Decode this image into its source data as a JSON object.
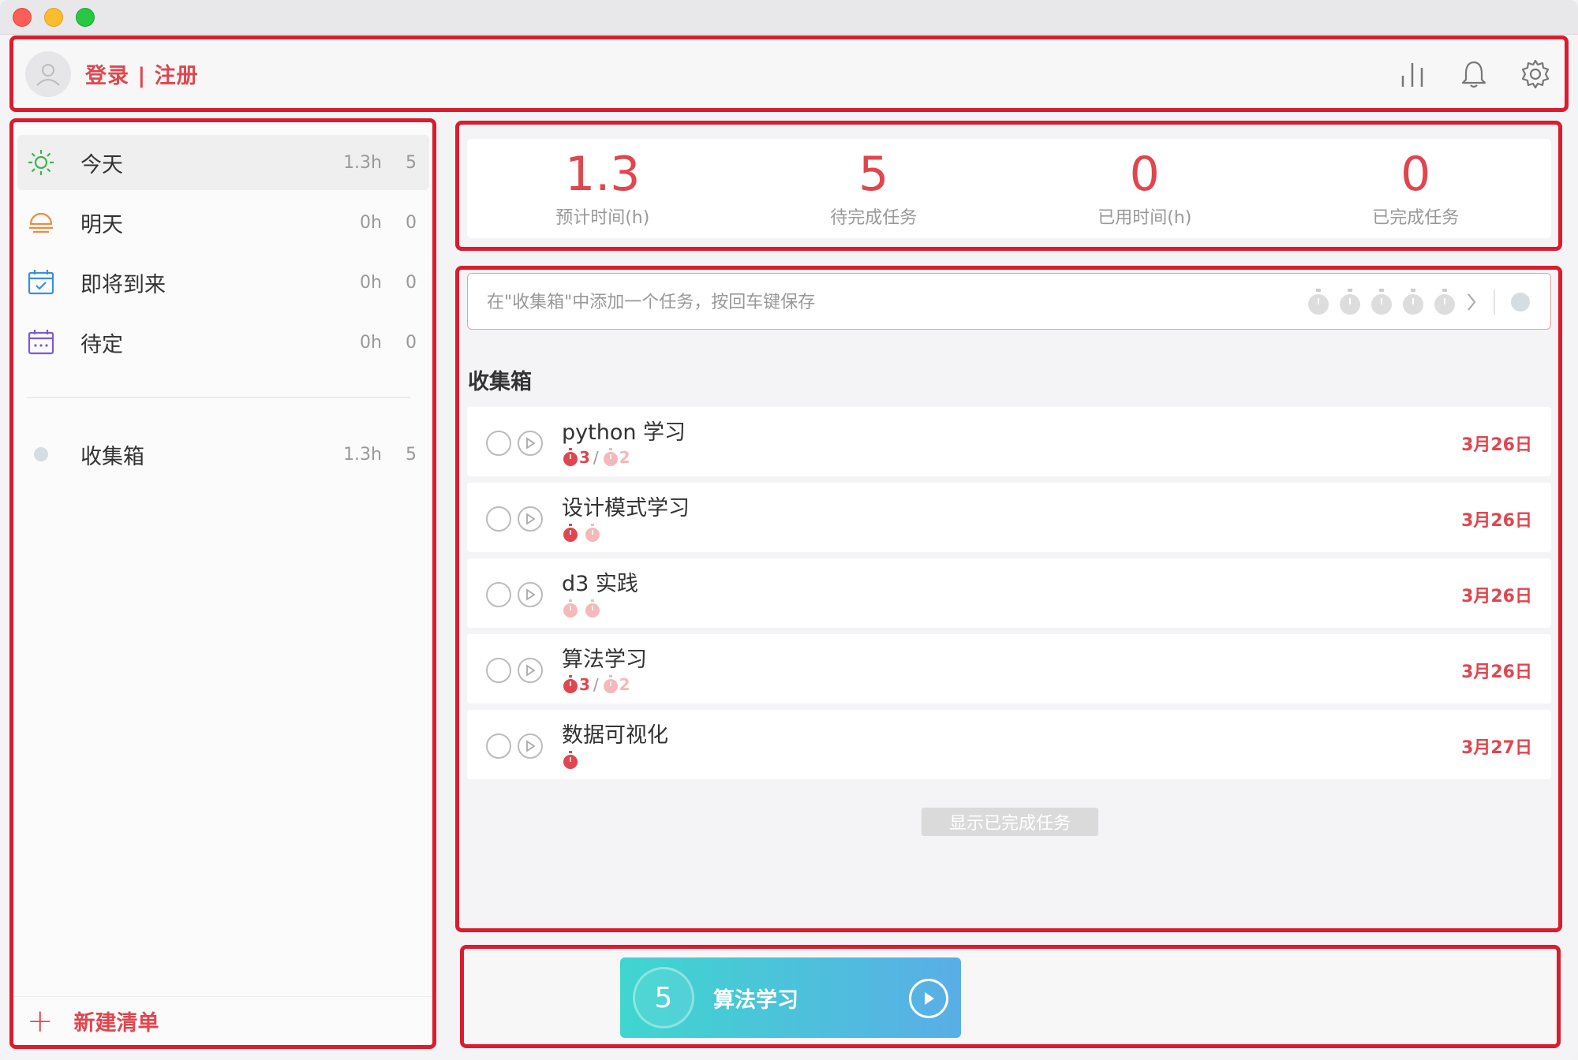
{
  "header": {
    "login_label": "登录 | 注册"
  },
  "sidebar": {
    "items": [
      {
        "label": "今天",
        "hours": "1.3h",
        "count": "5",
        "icon": "sun-icon",
        "color": "#3bb54a"
      },
      {
        "label": "明天",
        "hours": "0h",
        "count": "0",
        "icon": "sunrise-icon",
        "color": "#f08a3c"
      },
      {
        "label": "即将到来",
        "hours": "0h",
        "count": "0",
        "icon": "calendar-check-icon",
        "color": "#3b8ee0"
      },
      {
        "label": "待定",
        "hours": "0h",
        "count": "0",
        "icon": "calendar-dots-icon",
        "color": "#7a5ccf"
      }
    ],
    "lists": [
      {
        "label": "收集箱",
        "hours": "1.3h",
        "count": "5"
      }
    ],
    "new_list_label": "新建清单"
  },
  "stats": [
    {
      "value": "1.3",
      "caption": "预计时间(h)"
    },
    {
      "value": "5",
      "caption": "待完成任务"
    },
    {
      "value": "0",
      "caption": "已用时间(h)"
    },
    {
      "value": "0",
      "caption": "已完成任务"
    }
  ],
  "add_task": {
    "placeholder": "在\"收集箱\"中添加一个任务，按回车键保存"
  },
  "section_title": "收集箱",
  "tasks": [
    {
      "name": "python 学习",
      "done_count": "3",
      "separator": "/",
      "plan_count": "2",
      "date": "3月26日"
    },
    {
      "name": "设计模式学习",
      "date": "3月26日"
    },
    {
      "name": "d3 实践",
      "date": "3月26日"
    },
    {
      "name": "算法学习",
      "done_count": "3",
      "separator": "/",
      "plan_count": "2",
      "date": "3月26日"
    },
    {
      "name": "数据可视化",
      "date": "3月27日"
    }
  ],
  "show_completed_label": "显示已完成任务",
  "player": {
    "count": "5",
    "task_name": "算法学习"
  },
  "colors": {
    "accent": "#e0464e",
    "highlight_box": "#dc1c2e"
  }
}
